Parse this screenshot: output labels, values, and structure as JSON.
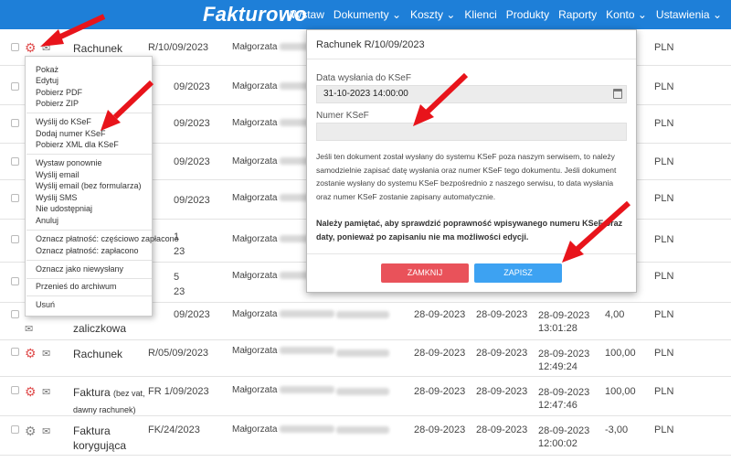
{
  "app": {
    "logo": "Fakturowo",
    "nav": [
      "Wystaw",
      "Dokumenty",
      "Koszty",
      "Klienci",
      "Produkty",
      "Raporty",
      "Konto",
      "Ustawienia"
    ]
  },
  "rows": [
    {
      "type": "Rachunek",
      "type_small": "",
      "number": "R/10/09/2023",
      "who": "Małgorzata",
      "d1": "",
      "d2": "",
      "d3": "",
      "d3b": "",
      "amount": "",
      "cur": "PLN"
    },
    {
      "type": "",
      "type_small": "",
      "number": "09/2023",
      "who": "Małgorzata",
      "d1": "",
      "d2": "",
      "d3": "",
      "d3b": "",
      "amount": "",
      "cur": "PLN"
    },
    {
      "type": "",
      "type_small": "",
      "number": "09/2023",
      "who": "Małgorzata",
      "d1": "",
      "d2": "",
      "d3": "",
      "d3b": "",
      "amount": "",
      "cur": "PLN"
    },
    {
      "type": "",
      "type_small": "",
      "number": "09/2023",
      "who": "Małgorzata",
      "d1": "",
      "d2": "",
      "d3": "",
      "d3b": "",
      "amount": "",
      "cur": "PLN"
    },
    {
      "type": "",
      "type_small": "",
      "number": "09/2023",
      "who": "Małgorzata",
      "d1": "",
      "d2": "",
      "d3": "",
      "d3b": "",
      "amount": "",
      "cur": "PLN"
    },
    {
      "type": "",
      "type_small": "",
      "number": "1",
      "number2": "23",
      "who": "Małgorzata",
      "d1": "",
      "d2": "",
      "d3": "",
      "d3b": "",
      "amount": "",
      "cur": "PLN"
    },
    {
      "type": "",
      "type_small": "",
      "number": "5",
      "number2": "23",
      "who": "Małgorzata",
      "d1": "",
      "d2": "",
      "d3": "",
      "d3b": "",
      "amount": "",
      "cur": "PLN"
    },
    {
      "type": "zaliczkowa",
      "type_small": "",
      "number": "09/2023",
      "who": "Małgorzata",
      "d1": "28-09-2023",
      "d2": "28-09-2023",
      "d3": "28-09-2023",
      "d3b": "13:01:28",
      "amount": "4,00",
      "cur": "PLN"
    },
    {
      "type": "Rachunek",
      "type_small": "",
      "number": "R/05/09/2023",
      "who": "Małgorzata",
      "d1": "28-09-2023",
      "d2": "28-09-2023",
      "d3": "28-09-2023",
      "d3b": "12:49:24",
      "amount": "100,00",
      "cur": "PLN"
    },
    {
      "type": "Faktura",
      "type_small": "(bez vat,",
      "type2": "dawny rachunek)",
      "number": "FR 1/09/2023",
      "who": "Małgorzata",
      "d1": "28-09-2023",
      "d2": "28-09-2023",
      "d3": "28-09-2023",
      "d3b": "12:47:46",
      "amount": "100,00",
      "cur": "PLN"
    },
    {
      "type": "Faktura",
      "type_small": "",
      "type2": "korygująca",
      "number": "FK/24/2023",
      "who": "Małgorzata",
      "d1": "28-09-2023",
      "d2": "28-09-2023",
      "d3": "28-09-2023",
      "d3b": "12:00:02",
      "amount": "-3,00",
      "cur": "PLN"
    }
  ],
  "menu": {
    "g1": [
      "Pokaż",
      "Edytuj",
      "Pobierz PDF",
      "Pobierz ZIP"
    ],
    "g2": [
      "Wyślij do KSeF",
      "Dodaj numer KSeF",
      "Pobierz XML dla KSeF"
    ],
    "g3": [
      "Wystaw ponownie",
      "Wyślij email",
      "Wyślij email (bez formularza)",
      "Wyślij SMS",
      "Nie udostępniaj",
      "Anuluj"
    ],
    "g4": [
      "Oznacz płatność: częściowo zapłacono",
      "Oznacz płatność: zapłacono"
    ],
    "g5": [
      "Oznacz jako niewysłany"
    ],
    "g6": [
      "Przenieś do archiwum"
    ],
    "g7": [
      "Usuń"
    ]
  },
  "modal": {
    "title": "Rachunek R/10/09/2023",
    "date_label": "Data wysłania do KSeF",
    "date_value": "31-10-2023 14:00:00",
    "ksef_label": "Numer KSeF",
    "ksef_value": "",
    "info": "Jeśli ten dokument został wysłany do systemu KSeF poza naszym serwisem, to należy samodzielnie zapisać datę wysłania oraz numer KSeF tego dokumentu. Jeśli dokument zostanie wysłany do systemu KSeF bezpośrednio z naszego serwisu, to data wysłania oraz numer KSeF zostanie zapisany automatycznie.",
    "warning": "Należy pamiętać, aby sprawdzić poprawność wpisywanego numeru KSeF oraz daty, ponieważ po zapisaniu nie ma możliwości edycji.",
    "close": "ZAMKNIJ",
    "save": "ZAPISZ"
  },
  "colors": {
    "header": "#1e7fd8",
    "close": "#e9525a",
    "save": "#3da2f2",
    "arrow": "#e8141b"
  }
}
